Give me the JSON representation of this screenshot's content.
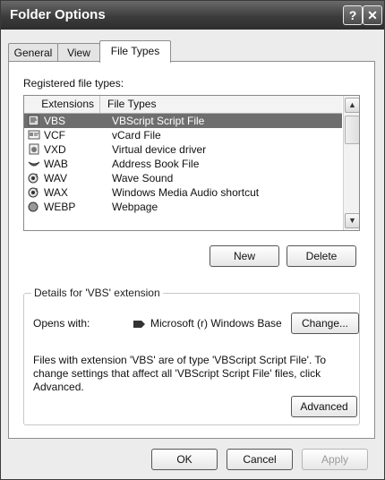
{
  "window": {
    "title": "Folder Options",
    "help_glyph": "?",
    "close_glyph": "✕"
  },
  "tabs": [
    {
      "label": "General"
    },
    {
      "label": "View"
    },
    {
      "label": "File Types",
      "active": true
    }
  ],
  "registered": {
    "label": "Registered file types:",
    "columns": [
      "Extensions",
      "File Types"
    ],
    "rows": [
      {
        "ext": "VBS",
        "type": "VBScript Script File",
        "icon": "script-file-icon",
        "selected": true
      },
      {
        "ext": "VCF",
        "type": "vCard File",
        "icon": "vcard-file-icon"
      },
      {
        "ext": "VXD",
        "type": "Virtual device driver",
        "icon": "driver-file-icon"
      },
      {
        "ext": "WAB",
        "type": "Address Book File",
        "icon": "address-book-icon"
      },
      {
        "ext": "WAV",
        "type": "Wave Sound",
        "icon": "sound-file-icon"
      },
      {
        "ext": "WAX",
        "type": "Windows Media Audio shortcut",
        "icon": "sound-file-icon"
      },
      {
        "ext": "WEBP",
        "type": "Webpage",
        "icon": "media-file-icon"
      }
    ]
  },
  "buttons": {
    "new": "New",
    "delete": "Delete",
    "change": "Change...",
    "advanced": "Advanced",
    "ok": "OK",
    "cancel": "Cancel",
    "apply": "Apply"
  },
  "details": {
    "legend": "Details for 'VBS' extension",
    "opens_with_label": "Opens with:",
    "opens_with_app": "Microsoft (r) Windows Base",
    "description": "Files with extension 'VBS' are of type 'VBScript Script File'.  To change settings that affect all 'VBScript Script File' files, click Advanced."
  },
  "colors": {
    "titlebar": "#3c3c3c",
    "selection": "#6e6e6e"
  }
}
